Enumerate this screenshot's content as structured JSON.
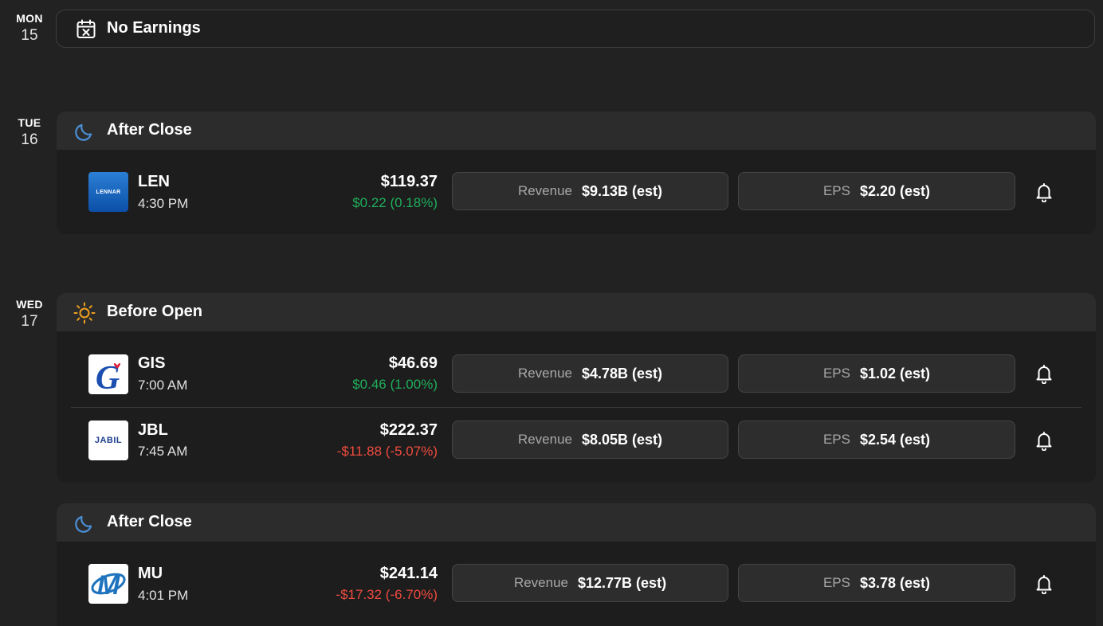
{
  "colors": {
    "positive": "#1fae5b",
    "negative": "#ef4b3f",
    "moon": "#4a8fd6",
    "sun": "#f0a020"
  },
  "days": [
    {
      "dow": "MON",
      "num": "15",
      "no_earnings_label": "No Earnings",
      "icon": "calendar-x-icon"
    },
    {
      "dow": "TUE",
      "num": "16",
      "sessions": [
        {
          "label": "After Close",
          "icon": "moon-icon",
          "rows": [
            {
              "ticker": "LEN",
              "time": "4:30 PM",
              "price": "$119.37",
              "change": "$0.22 (0.18%)",
              "direction": "up",
              "revenue_label": "Revenue",
              "revenue": "$9.13B (est)",
              "eps_label": "EPS",
              "eps": "$2.20 (est)",
              "logo_text": "LENNAR"
            }
          ]
        }
      ]
    },
    {
      "dow": "WED",
      "num": "17",
      "sessions": [
        {
          "label": "Before Open",
          "icon": "sun-icon",
          "rows": [
            {
              "ticker": "GIS",
              "time": "7:00 AM",
              "price": "$46.69",
              "change": "$0.46 (1.00%)",
              "direction": "up",
              "revenue_label": "Revenue",
              "revenue": "$4.78B (est)",
              "eps_label": "EPS",
              "eps": "$1.02 (est)",
              "logo_text": "G"
            },
            {
              "ticker": "JBL",
              "time": "7:45 AM",
              "price": "$222.37",
              "change": "-$11.88 (-5.07%)",
              "direction": "down",
              "revenue_label": "Revenue",
              "revenue": "$8.05B (est)",
              "eps_label": "EPS",
              "eps": "$2.54 (est)",
              "logo_text": "JABIL"
            }
          ]
        },
        {
          "label": "After Close",
          "icon": "moon-icon",
          "rows": [
            {
              "ticker": "MU",
              "time": "4:01 PM",
              "price": "$241.14",
              "change": "-$17.32 (-6.70%)",
              "direction": "down",
              "revenue_label": "Revenue",
              "revenue": "$12.77B (est)",
              "eps_label": "EPS",
              "eps": "$3.78 (est)",
              "logo_text": "M"
            }
          ]
        }
      ]
    }
  ]
}
